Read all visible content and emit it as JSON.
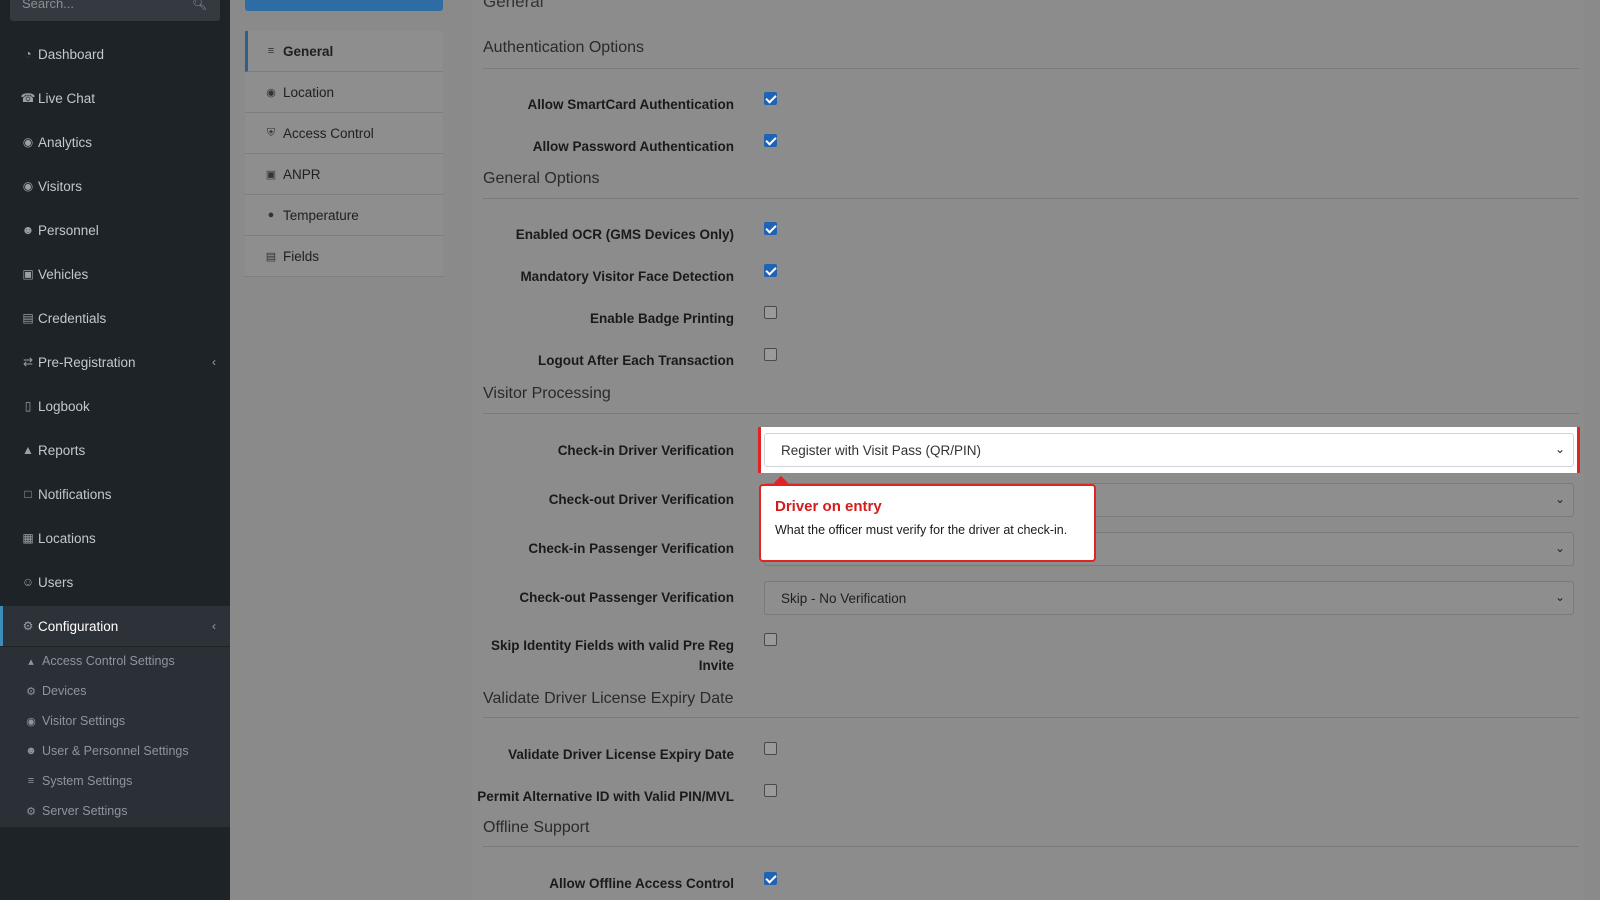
{
  "sidebar": {
    "search_placeholder": "Search...",
    "items": [
      {
        "label": "Dashboard",
        "icon": "dashboard-icon"
      },
      {
        "label": "Live Chat",
        "icon": "headset-icon"
      },
      {
        "label": "Analytics",
        "icon": "target-icon"
      },
      {
        "label": "Visitors",
        "icon": "eye-icon"
      },
      {
        "label": "Personnel",
        "icon": "user-gear-icon"
      },
      {
        "label": "Vehicles",
        "icon": "car-icon"
      },
      {
        "label": "Credentials",
        "icon": "id-card-icon"
      },
      {
        "label": "Pre-Registration",
        "icon": "exchange-icon"
      },
      {
        "label": "Logbook",
        "icon": "book-icon"
      },
      {
        "label": "Reports",
        "icon": "chart-icon"
      },
      {
        "label": "Notifications",
        "icon": "chat-icon"
      },
      {
        "label": "Locations",
        "icon": "building-icon"
      },
      {
        "label": "Users",
        "icon": "users-icon"
      },
      {
        "label": "Configuration",
        "icon": "gear-icon"
      }
    ],
    "sub_items": [
      {
        "label": "Access Control Settings",
        "icon": "lock-icon"
      },
      {
        "label": "Devices",
        "icon": "device-icon"
      },
      {
        "label": "Visitor Settings",
        "icon": "eye-icon"
      },
      {
        "label": "User & Personnel Settings",
        "icon": "user-gear-icon"
      },
      {
        "label": "System Settings",
        "icon": "sliders-icon"
      },
      {
        "label": "Server Settings",
        "icon": "server-icon"
      }
    ]
  },
  "settings_menu": [
    {
      "label": "General",
      "icon": "sliders-icon"
    },
    {
      "label": "Location",
      "icon": "map-pin-icon"
    },
    {
      "label": "Access Control",
      "icon": "shield-icon"
    },
    {
      "label": "ANPR",
      "icon": "car-icon"
    },
    {
      "label": "Temperature",
      "icon": "thermometer-icon"
    },
    {
      "label": "Fields",
      "icon": "form-icon"
    }
  ],
  "main": {
    "title": "General",
    "sections": {
      "auth": "Authentication Options",
      "general": "General Options",
      "visitor": "Visitor Processing",
      "license": "Validate Driver License Expiry Date",
      "offline": "Offline Support"
    },
    "fields": {
      "smartcard": {
        "label": "Allow SmartCard Authentication",
        "checked": true
      },
      "password": {
        "label": "Allow Password Authentication",
        "checked": true
      },
      "ocr": {
        "label": "Enabled OCR (GMS Devices Only)",
        "checked": true
      },
      "face": {
        "label": "Mandatory Visitor Face Detection",
        "checked": true
      },
      "badge": {
        "label": "Enable Badge Printing",
        "checked": false
      },
      "logout": {
        "label": "Logout After Each Transaction",
        "checked": false
      },
      "checkin_driver": {
        "label": "Check-in Driver Verification",
        "value": "Register with Visit Pass (QR/PIN)"
      },
      "checkout_driver": {
        "label": "Check-out Driver Verification",
        "value": ""
      },
      "checkin_passenger": {
        "label": "Check-in Passenger Verification",
        "value": ""
      },
      "checkout_passenger": {
        "label": "Check-out Passenger Verification",
        "value": "Skip - No Verification"
      },
      "skip_identity": {
        "label_line1": "Skip Identity Fields with valid Pre Reg",
        "label_line2": "Invite",
        "checked": false
      },
      "validate_license": {
        "label": "Validate Driver License Expiry Date",
        "checked": false
      },
      "permit_alt": {
        "label": "Permit Alternative ID with Valid PIN/MVL",
        "checked": false
      },
      "offline_access": {
        "label": "Allow Offline Access Control",
        "checked": true
      }
    }
  },
  "tooltip": {
    "title": "Driver on entry",
    "body": "What the officer must verify for the driver at check-in."
  },
  "colors": {
    "sidebar_bg": "#1e2328",
    "accent": "#3c8dbc",
    "highlight": "#e02424",
    "checkbox_checked": "#1e63b5"
  }
}
